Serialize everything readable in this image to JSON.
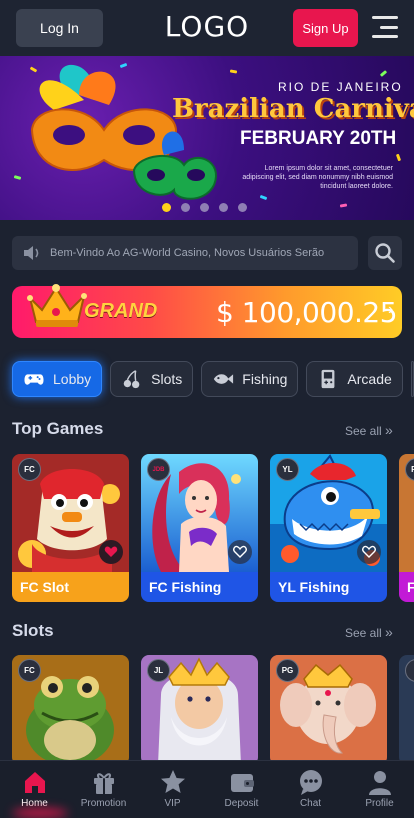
{
  "header": {
    "login_label": "Log In",
    "logo_text": "LOGO",
    "signup_label": "Sign Up",
    "signup_color": "#e8164e"
  },
  "banner": {
    "city": "RIO DE JANEIRO",
    "title": "Brazilian Carnival",
    "date": "FEBRUARY 20TH",
    "body": "Lorem ipsum dolor sit amet, consectetuer adipiscing elit, sed diam nonummy nibh euismod tincidunt laoreet dolore.",
    "slide_count": 5,
    "active_slide": 1
  },
  "notice": {
    "text": "Bem-Vindo Ao AG-World Casino, Novos Usuários Serão",
    "icon": "speaker-icon"
  },
  "jackpot": {
    "label": "GRAND",
    "amount": "$ 100,000.25"
  },
  "categories": [
    {
      "label": "Lobby",
      "icon": "gamepad-icon",
      "active": true
    },
    {
      "label": "Slots",
      "icon": "cherry-icon",
      "active": false
    },
    {
      "label": "Fishing",
      "icon": "fish-icon",
      "active": false
    },
    {
      "label": "Arcade",
      "icon": "handheld-icon",
      "active": false
    }
  ],
  "top_games": {
    "title": "Top Games",
    "see_all": "See all",
    "items": [
      {
        "name": "FC Slot",
        "provider": "FC",
        "color": "#f7a21b",
        "favorited": true
      },
      {
        "name": "FC Fishing",
        "provider": "JDB",
        "color": "#1f55e6",
        "favorited": false
      },
      {
        "name": "YL Fishing",
        "provider": "YL",
        "color": "#1f55e6",
        "favorited": false
      },
      {
        "name": "F",
        "provider": "FC",
        "color": "#c21ad6",
        "favorited": false
      }
    ]
  },
  "slots": {
    "title": "Slots",
    "see_all": "See all",
    "items": [
      {
        "provider": "FC"
      },
      {
        "provider": "JL"
      },
      {
        "provider": "PG"
      },
      {
        "provider": ""
      }
    ]
  },
  "nav": [
    {
      "label": "Home",
      "icon": "home-icon",
      "active": true
    },
    {
      "label": "Promotion",
      "icon": "gift-icon",
      "active": false
    },
    {
      "label": "VIP",
      "icon": "star-icon",
      "active": false
    },
    {
      "label": "Deposit",
      "icon": "wallet-icon",
      "active": false
    },
    {
      "label": "Chat",
      "icon": "chat-icon",
      "active": false
    },
    {
      "label": "Profile",
      "icon": "user-icon",
      "active": false
    }
  ]
}
